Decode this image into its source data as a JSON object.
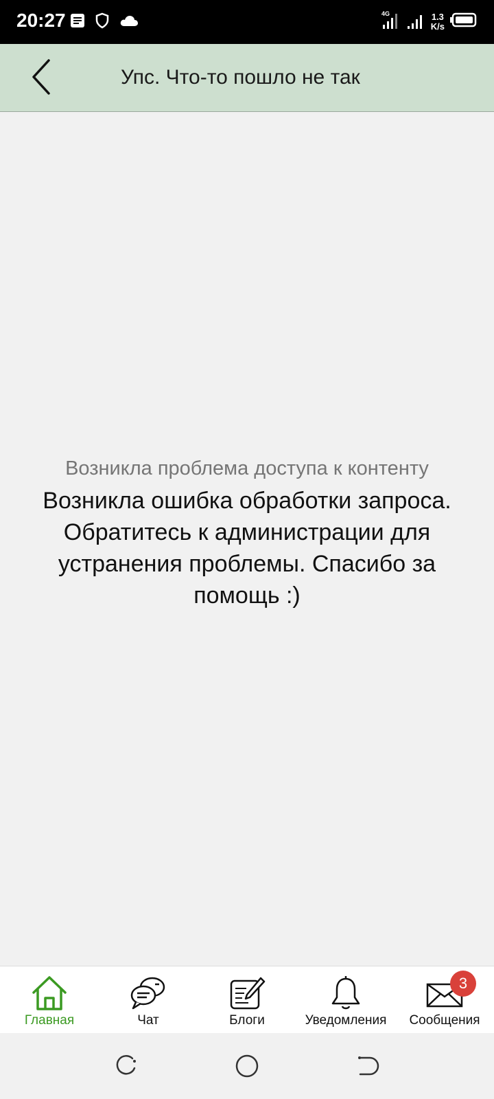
{
  "status_bar": {
    "time": "20:27",
    "network_type": "4G",
    "speed_value": "1.3",
    "speed_unit": "K/s",
    "icons_left": [
      "notes-icon",
      "shield-icon",
      "cloud-icon"
    ],
    "icons_right": [
      "signal-4g-icon",
      "signal-icon",
      "battery-icon"
    ]
  },
  "header": {
    "title": "Упс. Что-то пошло не так",
    "back_icon": "chevron-left-icon",
    "background_color": "#cddfcf"
  },
  "error": {
    "subtitle": "Возникла проблема доступа к контенту",
    "message": "Возникла ошибка обработки запроса. Обратитесь к администрации для устранения проблемы. Спасибо за помощь :)"
  },
  "bottom_nav": {
    "items": [
      {
        "label": "Главная",
        "icon": "home-icon",
        "active": true
      },
      {
        "label": "Чат",
        "icon": "chat-icon",
        "active": false
      },
      {
        "label": "Блоги",
        "icon": "blog-icon",
        "active": false
      },
      {
        "label": "Уведомления",
        "icon": "bell-icon",
        "active": false
      },
      {
        "label": "Сообщения",
        "icon": "envelope-icon",
        "active": false,
        "badge": "3"
      }
    ],
    "active_color": "#3b9a22",
    "badge_color": "#d9413a"
  },
  "system_nav": {
    "buttons": [
      "recents-icon",
      "home-circle-icon",
      "back-gesture-icon"
    ]
  }
}
